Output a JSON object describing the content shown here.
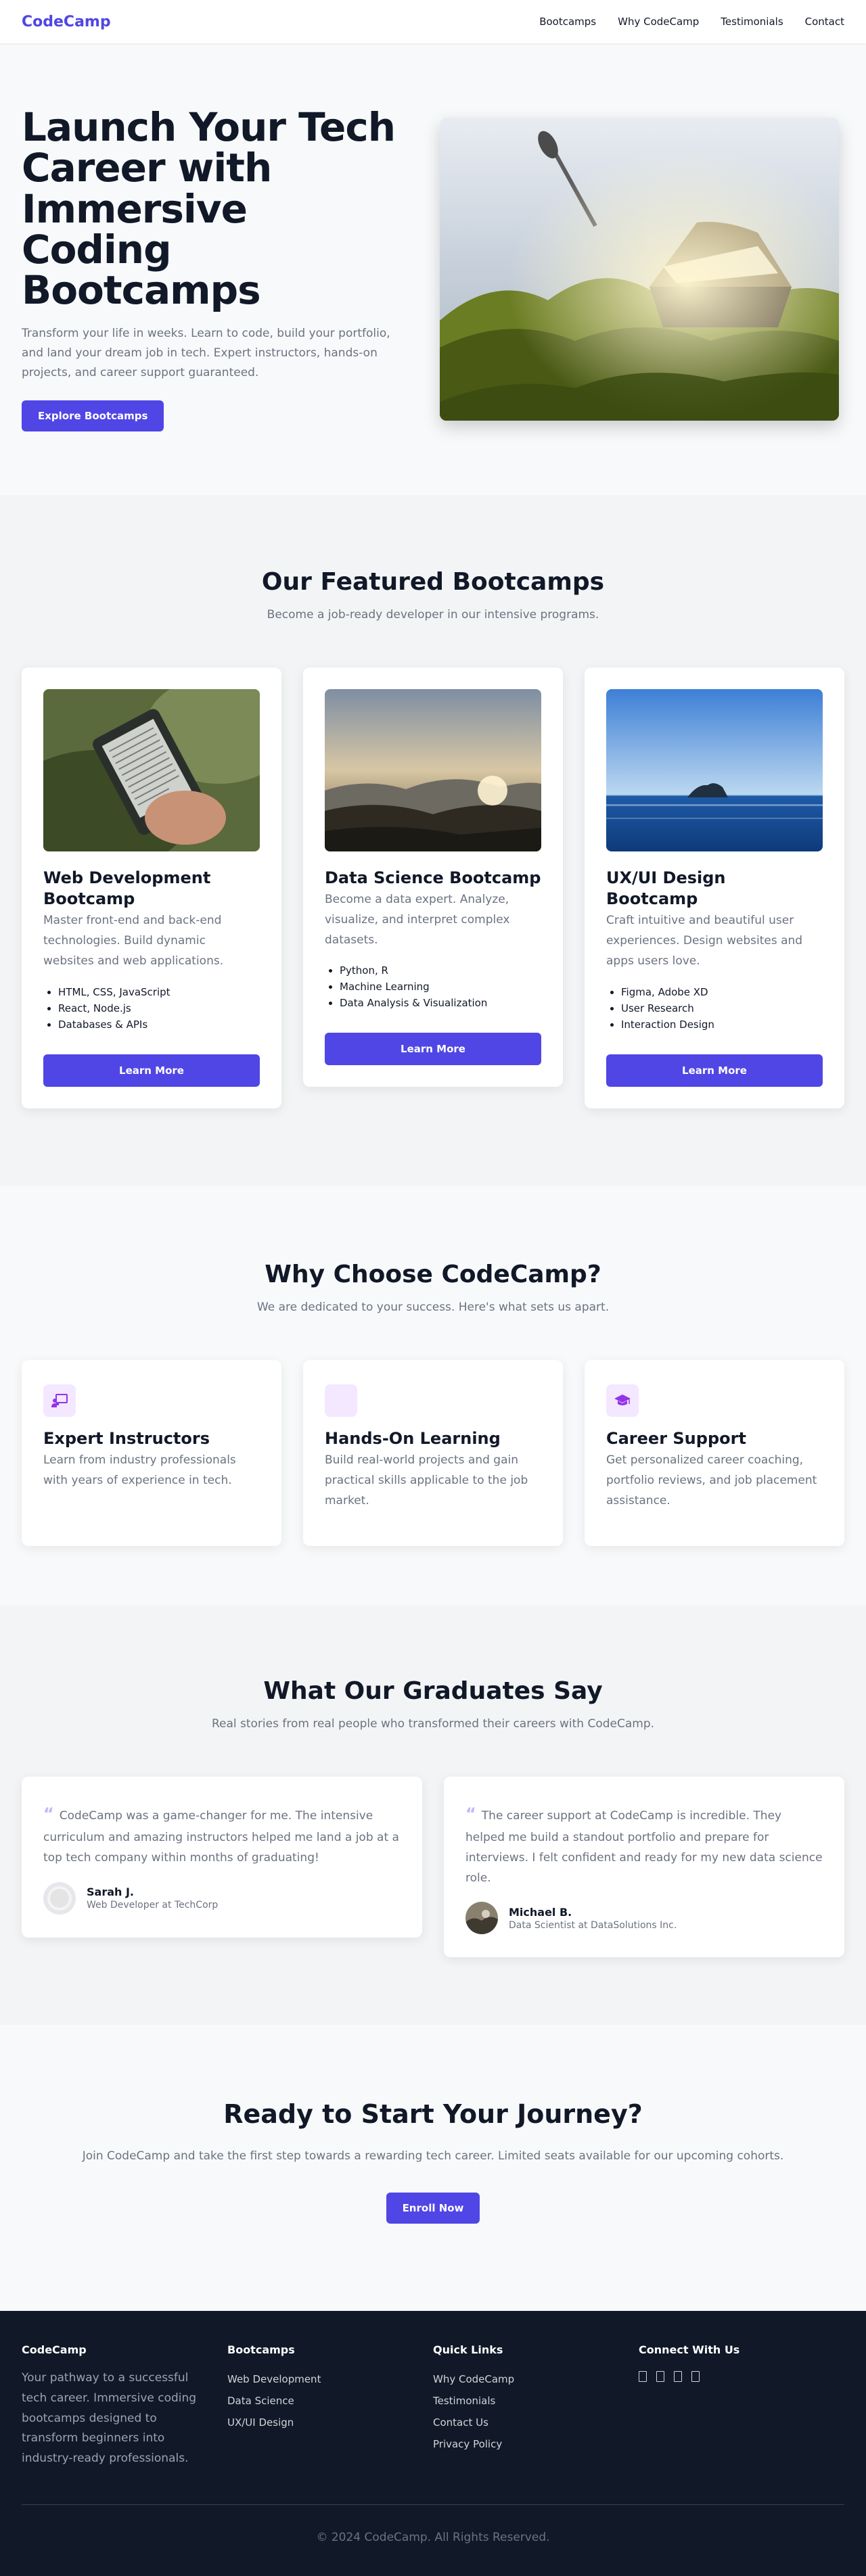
{
  "header": {
    "logo": "CodeCamp",
    "nav": [
      "Bootcamps",
      "Why CodeCamp",
      "Testimonials",
      "Contact"
    ]
  },
  "hero": {
    "title": "Launch Your Tech Career with Immersive Coding Bootcamps",
    "description": "Transform your life in weeks. Learn to code, build your portfolio, and land your dream job in tech. Expert instructors, hands-on projects, and career support guaranteed.",
    "button": "Explore Bootcamps"
  },
  "featured": {
    "title": "Our Featured Bootcamps",
    "subtitle": "Become a job-ready developer in our intensive programs.",
    "cards": [
      {
        "title": "Web Development Bootcamp",
        "description": "Master front-end and back-end technologies. Build dynamic websites and web applications.",
        "items": [
          "HTML, CSS, JavaScript",
          "React, Node.js",
          "Databases & APIs"
        ],
        "button": "Learn More"
      },
      {
        "title": "Data Science Bootcamp",
        "description": "Become a data expert. Analyze, visualize, and interpret complex datasets.",
        "items": [
          "Python, R",
          "Machine Learning",
          "Data Analysis & Visualization"
        ],
        "button": "Learn More"
      },
      {
        "title": "UX/UI Design Bootcamp",
        "description": "Craft intuitive and beautiful user experiences. Design websites and apps users love.",
        "items": [
          "Figma, Adobe XD",
          "User Research",
          "Interaction Design"
        ],
        "button": "Learn More"
      }
    ]
  },
  "why": {
    "title": "Why Choose CodeCamp?",
    "subtitle": "We are dedicated to your success. Here's what sets us apart.",
    "cards": [
      {
        "title": "Expert Instructors",
        "description": "Learn from industry professionals with years of experience in tech.",
        "icon": "chalkboard-teacher-icon"
      },
      {
        "title": "Hands-On Learning",
        "description": "Build real-world projects and gain practical skills applicable to the job market.",
        "icon": "blank-icon"
      },
      {
        "title": "Career Support",
        "description": "Get personalized career coaching, portfolio reviews, and job placement assistance.",
        "icon": "graduation-cap-icon"
      }
    ]
  },
  "testimonials": {
    "title": "What Our Graduates Say",
    "subtitle": "Real stories from real people who transformed their careers with CodeCamp.",
    "items": [
      {
        "quote": "CodeCamp was a game-changer for me. The intensive curriculum and amazing instructors helped me land a job at a top tech company within months of graduating!",
        "name": "Sarah J.",
        "role": "Web Developer at TechCorp"
      },
      {
        "quote": "The career support at CodeCamp is incredible. They helped me build a standout portfolio and prepare for interviews. I felt confident and ready for my new data science role.",
        "name": "Michael B.",
        "role": "Data Scientist at DataSolutions Inc."
      }
    ]
  },
  "cta": {
    "title": "Ready to Start Your Journey?",
    "description": "Join CodeCamp and take the first step towards a rewarding tech career. Limited seats available for our upcoming cohorts.",
    "button": "Enroll Now"
  },
  "footer": {
    "brand": {
      "title": "CodeCamp",
      "about": "Your pathway to a successful tech career. Immersive coding bootcamps designed to transform beginners into industry-ready professionals."
    },
    "bootcamps": {
      "title": "Bootcamps",
      "links": [
        "Web Development",
        "Data Science",
        "UX/UI Design"
      ]
    },
    "quick": {
      "title": "Quick Links",
      "links": [
        "Why CodeCamp",
        "Testimonials",
        "Contact Us",
        "Privacy Policy"
      ]
    },
    "connect": {
      "title": "Connect With Us"
    },
    "copyright": "© 2024 CodeCamp. All Rights Reserved."
  },
  "colors": {
    "accent": "#4f46e5",
    "footer_bg": "#111827",
    "icon_bg": "#f3e8ff"
  }
}
